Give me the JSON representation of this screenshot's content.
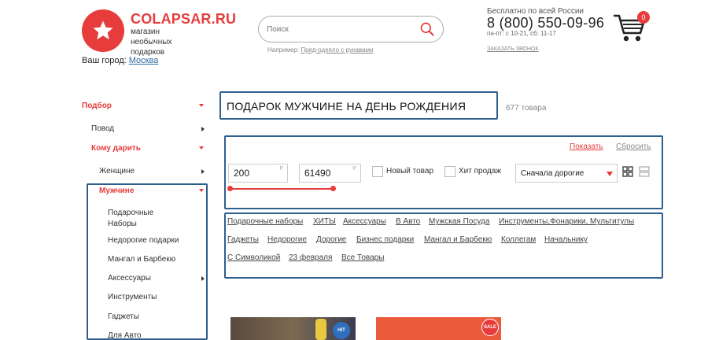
{
  "header": {
    "logo_name": "COLAPSAR.RU",
    "logo_tagline": "магазин необычных подарков",
    "city_label": "Ваш город:",
    "city_value": "Москва",
    "search": {
      "placeholder": "Поиск",
      "hint_prefix": "Например:",
      "hint_example": "Пред-одеяло с рукавами"
    },
    "contact": {
      "free_call": "Бесплатно по всей России",
      "phone": "8 (800) 550-09-96",
      "hours": "пн-пт: с 10-21, сб: 11-17",
      "callback": "ЗАКАЗАТЬ ЗВОНОК"
    },
    "cart_count": "0"
  },
  "sidebar": {
    "section_title": "Подбор",
    "items": [
      {
        "label": "Повод"
      },
      {
        "label": "Кому дарить"
      },
      {
        "label": "Женщине"
      },
      {
        "label": "Мужчине"
      }
    ],
    "sub_items": [
      {
        "label": "Подарочные Наборы"
      },
      {
        "label": "Недорогие подарки"
      },
      {
        "label": "Мангал и Барбекю"
      },
      {
        "label": "Аксессуары"
      },
      {
        "label": "Инструменты"
      },
      {
        "label": "Гаджеты"
      },
      {
        "label": "Для Авто"
      }
    ]
  },
  "main": {
    "title": "ПОДАРОК МУЖЧИНЕ НА ДЕНЬ РОЖДЕНИЯ",
    "count": "677 товара"
  },
  "filters": {
    "show_label": "Показать",
    "reset_label": "Сбросить",
    "price_min": "200",
    "price_max": "61490",
    "currency": "Р",
    "new_label": "Новый товар",
    "hit_label": "Хит продаж",
    "sort_value": "Сначала дорогие"
  },
  "tags": [
    "Подарочные наборы",
    "ХИТЫ",
    "Аксессуары",
    "В Авто",
    "Мужская Посуда",
    "Инструменты,Фонарики, Мультитулы",
    "Гаджеты",
    "Недорогие",
    "Дорогие",
    "Бизнес подарки",
    "Мангал и Барбекю",
    "Коллегам",
    "Начальнику",
    "С Символикой",
    "23 февраля",
    "Все Товары"
  ],
  "products": {
    "badge_hit": "HIT",
    "badge_sale": "SALE"
  },
  "colors": {
    "accent": "#e63c3c",
    "outline": "#2f5f8e",
    "link": "#2b6aa0"
  }
}
